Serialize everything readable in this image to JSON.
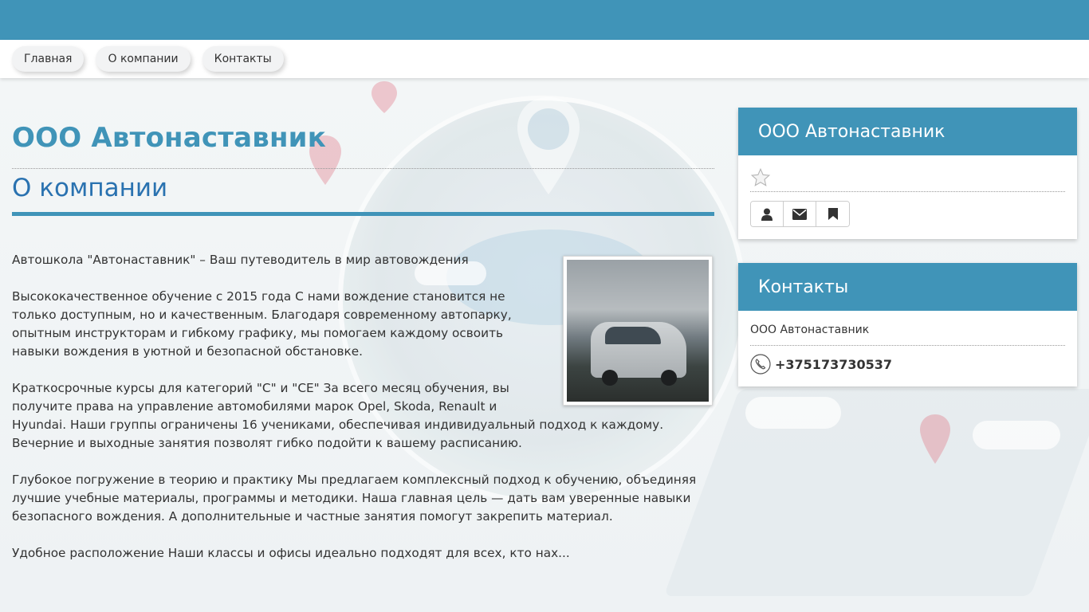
{
  "colors": {
    "brand_blue": "#4094b8",
    "section_blue": "#2a72b0",
    "text": "#333333"
  },
  "nav": {
    "items": [
      {
        "label": "Главная"
      },
      {
        "label": "О компании"
      },
      {
        "label": "Контакты"
      }
    ]
  },
  "main": {
    "company_title": "ООО Автонаставник",
    "section_title": "О компании",
    "paragraphs": [
      "Автошкола \"Автонаставник\" – Ваш путеводитель в мир автовождения",
      "Высококачественное обучение с 2015 года С нами вождение становится не только доступным, но и качественным. Благодаря современному автопарку, опытным инструкторам и гибкому графику, мы помогаем каждому освоить навыки вождения в уютной и безопасной обстановке.",
      "Краткосрочные курсы для категорий \"C\" и \"CE\" За всего месяц обучения, вы получите права на управление автомобилями марок Opel, Skoda, Renault и Hyundai. Наши группы ограничены 16 учениками, обеспечивая индивидуальный подход к каждому. Вечерние и выходные занятия позволят гибко подойти к вашему расписанию.",
      "Глубокое погружение в теорию и практику Мы предлагаем комплексный подход к обучению, объединяя лучшие учебные материалы, программы и методики. Наша главная цель — дать вам уверенные навыки безопасного вождения. А дополнительные и частные занятия помогут закрепить материал.",
      "Удобное расположение Наши классы и офисы идеально подходят для всех, кто нах..."
    ],
    "photo_icon": "car-photo"
  },
  "sidebar": {
    "company_panel": {
      "title": "ООО Автонаставник",
      "icons": [
        "star-icon",
        "user-icon",
        "envelope-icon",
        "bookmark-icon"
      ]
    },
    "contacts_panel": {
      "title": "Контакты",
      "company_name": "ООО Автонаставник",
      "phone": "+375173730537",
      "phone_icon": "phone-icon"
    }
  }
}
